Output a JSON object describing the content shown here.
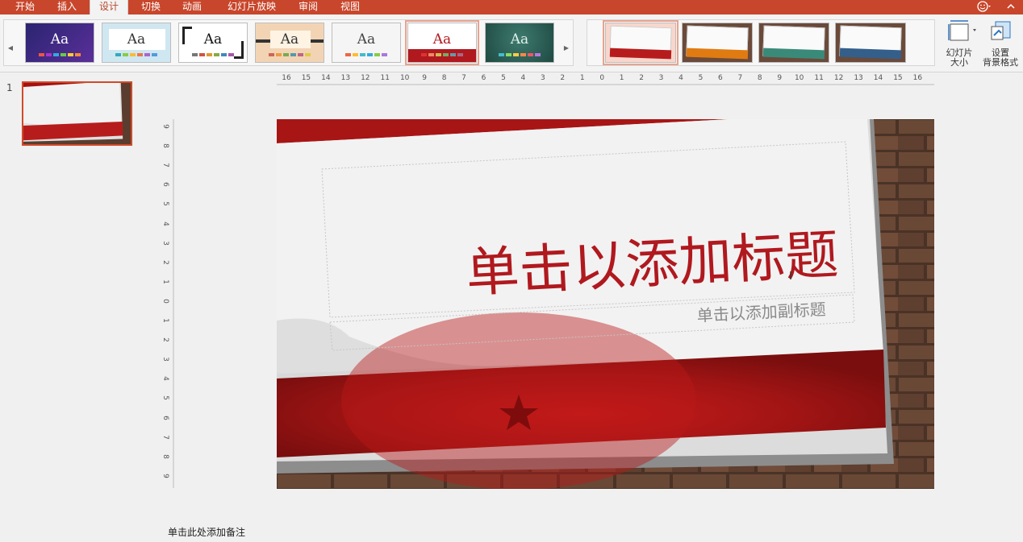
{
  "tabs": [
    "开始",
    "插入",
    "设计",
    "切换",
    "动画",
    "幻灯片放映",
    "审阅",
    "视图"
  ],
  "active_tab": "设计",
  "themes": [
    {
      "name": "theme-1",
      "aa": "Aa",
      "bg": "#3a2f8a",
      "fg": "#ffffff"
    },
    {
      "name": "theme-2",
      "aa": "Aa",
      "bg": "#cfe7f1",
      "fg": "#333333"
    },
    {
      "name": "theme-3",
      "aa": "Aa",
      "bg": "#ffffff",
      "fg": "#111111"
    },
    {
      "name": "theme-4",
      "aa": "Aa",
      "bg": "#f2d4b4",
      "fg": "#333333"
    },
    {
      "name": "theme-5",
      "aa": "Aa",
      "bg": "#f5f5f5",
      "fg": "#444444"
    },
    {
      "name": "theme-6",
      "aa": "Aa",
      "bg": "#ffffff",
      "fg": "#b0191e"
    },
    {
      "name": "theme-7",
      "aa": "Aa",
      "bg": "#2a5a50",
      "fg": "#e0f0ea"
    }
  ],
  "variants": [
    {
      "name": "variant-red",
      "bar": "#b71c1c"
    },
    {
      "name": "variant-orange",
      "bar": "#e07b12"
    },
    {
      "name": "variant-teal",
      "bar": "#3a8a7a"
    },
    {
      "name": "variant-blue",
      "bar": "#345f8a"
    }
  ],
  "ribbon_commands": {
    "slide_size_label": "幻灯片大小",
    "slide_size_line1": "幻灯片",
    "slide_size_line2": "大小",
    "format_bg_line1": "设置",
    "format_bg_line2": "背景格式"
  },
  "slide_pane": {
    "slide_number": "1"
  },
  "ruler_h": [
    "16",
    "15",
    "14",
    "13",
    "12",
    "11",
    "10",
    "9",
    "8",
    "7",
    "6",
    "5",
    "4",
    "3",
    "2",
    "1",
    "0",
    "1",
    "2",
    "3",
    "4",
    "5",
    "6",
    "7",
    "8",
    "9",
    "10",
    "11",
    "12",
    "13",
    "14",
    "15",
    "16"
  ],
  "ruler_v": [
    "9",
    "8",
    "7",
    "6",
    "5",
    "4",
    "3",
    "2",
    "1",
    "0",
    "1",
    "2",
    "3",
    "4",
    "5",
    "6",
    "7",
    "8",
    "9"
  ],
  "slide": {
    "title_placeholder": "单击以添加标题",
    "subtitle_placeholder": "单击以添加副标题"
  },
  "notes_placeholder": "单击此处添加备注",
  "colors": {
    "accent": "#c8462b",
    "theme_red": "#b0191e"
  }
}
